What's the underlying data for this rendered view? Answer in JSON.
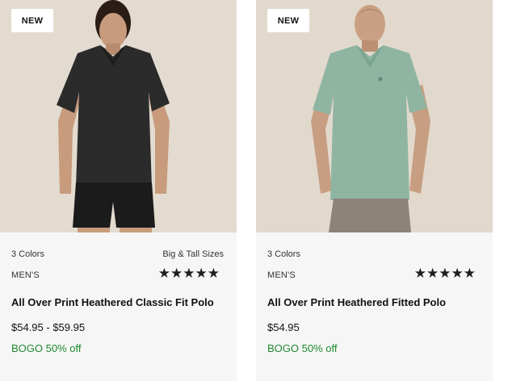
{
  "products": [
    {
      "badge": "NEW",
      "colors": "3 Colors",
      "sizes": "Big & Tall Sizes",
      "category": "MEN'S",
      "rating_stars": "★★★★★",
      "rating": 5,
      "name": "All Over Print Heathered Classic Fit Polo",
      "price": "$54.95 - $59.95",
      "promo": "BOGO 50% off",
      "photo_alt": "Man wearing black heathered polo and black shorts",
      "shirt_color": "#2b2b2b",
      "bottom_color": "#1b1b1b"
    },
    {
      "badge": "NEW",
      "colors": "3 Colors",
      "category": "MEN'S",
      "rating_stars": "★★★★★",
      "rating": 5,
      "name": "All Over Print Heathered Fitted Polo",
      "price": "$54.95",
      "promo": "BOGO 50% off",
      "photo_alt": "Man wearing sage green patterned polo and grey shorts",
      "shirt_color": "#8fb5a2",
      "bottom_color": "#8c8379"
    }
  ],
  "colors": {
    "promo_green": "#1f8a2e",
    "card_bg": "#f6f6f6",
    "photo_bg": "#e2d9cd"
  }
}
